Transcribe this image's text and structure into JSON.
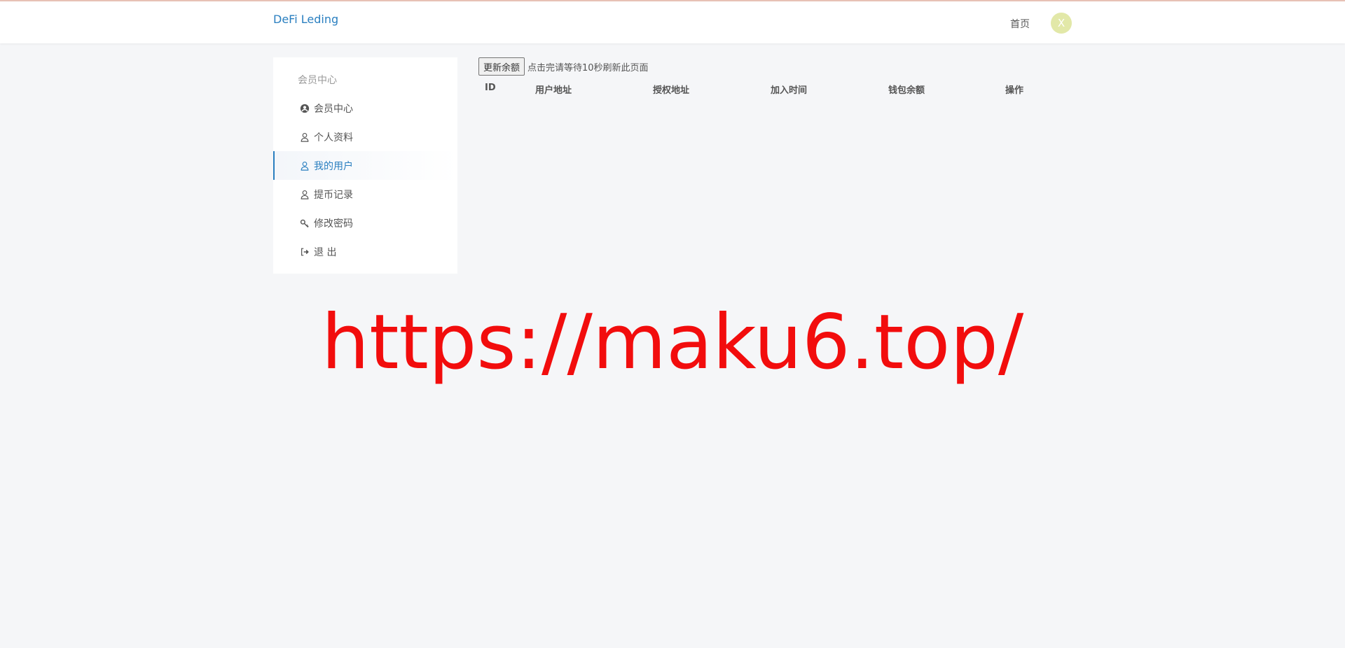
{
  "header": {
    "brand": "DeFi Leding",
    "home_link": "首页",
    "avatar_letter": "X",
    "avatar_color": "#e2e8a8",
    "brand_color": "#2a7fc0"
  },
  "sidebar": {
    "title": "会员中心",
    "items": [
      {
        "label": "会员中心",
        "icon": "user-circle-icon",
        "active": false
      },
      {
        "label": "个人资料",
        "icon": "user-icon",
        "active": false
      },
      {
        "label": "我的用户",
        "icon": "user-icon",
        "active": true
      },
      {
        "label": "提币记录",
        "icon": "user-icon",
        "active": false
      },
      {
        "label": "修改密码",
        "icon": "key-icon",
        "active": false
      },
      {
        "label": "退 出",
        "icon": "sign-out-icon",
        "active": false
      }
    ]
  },
  "main": {
    "refresh_button": "更新余额",
    "refresh_hint": "点击完请等待10秒刷新此页面",
    "table": {
      "columns": [
        "ID",
        "用户地址",
        "授权地址",
        "加入时间",
        "钱包余额",
        "操作"
      ]
    }
  },
  "watermark": {
    "text": "https://maku6.top/",
    "color": "#f20d0d"
  }
}
